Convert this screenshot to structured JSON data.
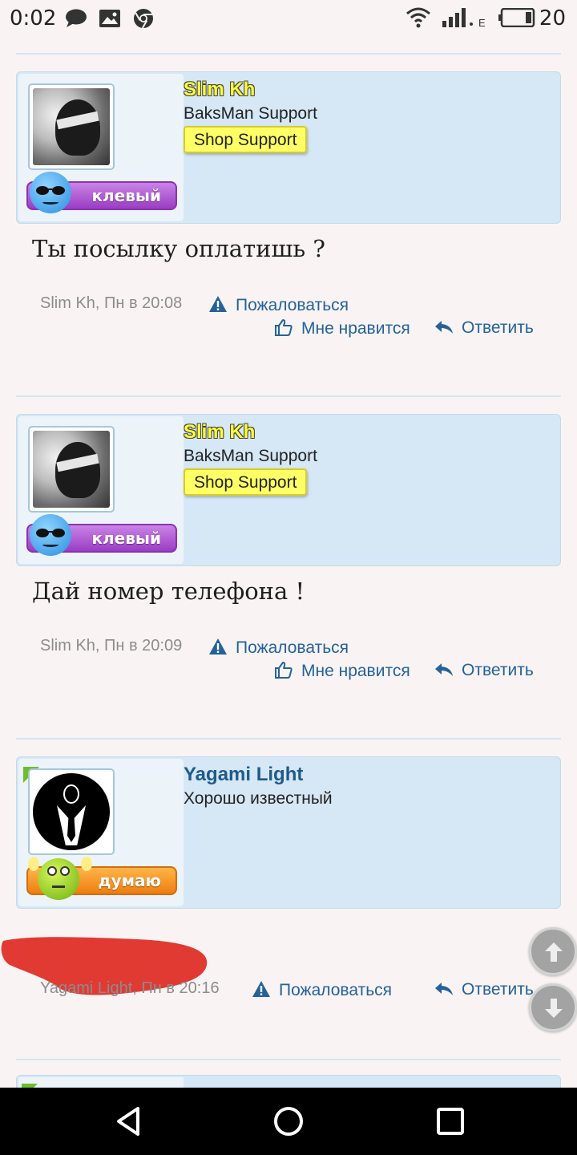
{
  "status_bar": {
    "time": "0:02",
    "network_type": "E",
    "battery": "20"
  },
  "posts": [
    {
      "username": "Slim Kh",
      "user_title": "BaksMan Support",
      "user_banner": "Shop Support",
      "status_label": "клевый",
      "message": "Ты посылку оплатишь ?",
      "meta": "Slim Kh, Пн в 20:08",
      "report_label": "Пожаловаться",
      "like_label": "Мне нравится",
      "reply_label": "Ответить"
    },
    {
      "username": "Slim Kh",
      "user_title": "BaksMan Support",
      "user_banner": "Shop Support",
      "status_label": "клевый",
      "message": "Дай номер телефона !",
      "meta": "Slim Kh, Пн в 20:09",
      "report_label": "Пожаловаться",
      "like_label": "Мне нравится",
      "reply_label": "Ответить"
    },
    {
      "username": "Yagami Light",
      "user_title": "Хорошо известный",
      "status_label": "думаю",
      "meta": "Yagami Light, Пн в 20:16",
      "report_label": "Пожаловаться",
      "reply_label": "Ответить"
    }
  ],
  "colors": {
    "accent_link": "#24629a",
    "card_bg": "#d6e7f5",
    "banner_yellow": "#ffff66",
    "redaction": "#e03a33"
  },
  "icons": [
    "message-icon",
    "image-icon",
    "chrome-icon",
    "wifi-icon",
    "signal-icon",
    "battery-icon",
    "warning-icon",
    "thumbs-up-icon",
    "reply-icon",
    "arrow-up-icon",
    "arrow-down-icon",
    "nav-back-icon",
    "nav-home-icon",
    "nav-recents-icon"
  ]
}
